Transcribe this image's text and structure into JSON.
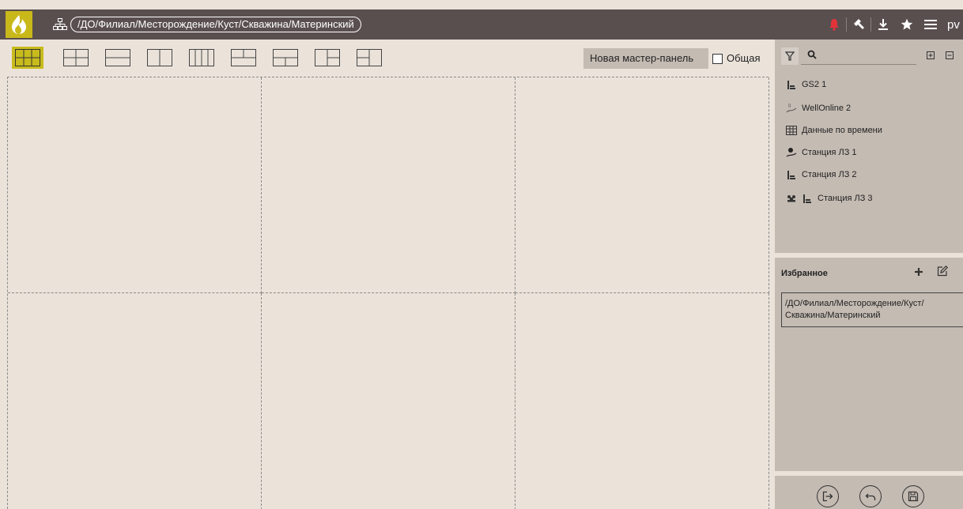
{
  "header": {
    "breadcrumb": "/ДО/Филиал/Месторождение/Куст/Скважина/Материнский",
    "user": "pv",
    "colors": {
      "bar": "#5a4f4f",
      "logo_bg": "#c9b81a",
      "bell": "#e0343a"
    },
    "icons": [
      "bell-icon",
      "hammer-icon",
      "download-icon",
      "star-icon",
      "menu-icon"
    ]
  },
  "toolbar": {
    "layouts": [
      "grid-3x2",
      "grid-2x2",
      "rows-2",
      "cols-2",
      "cols-4",
      "top-1-bottom-2",
      "top-2-bottom-1",
      "left-1-right-2",
      "left-2-right-1"
    ],
    "active_layout": "grid-3x2",
    "panel_name": "Новая мастер-панель",
    "common_label": "Общая",
    "common_checked": false
  },
  "tree": {
    "items": [
      {
        "label": "GS2 1",
        "icon": "pump-jack-icon"
      },
      {
        "label": "WellOnline 2",
        "icon": "well-signal-icon"
      },
      {
        "label": "Данные по времени",
        "icon": "table-icon"
      },
      {
        "label": "Станция ЛЗ 1",
        "icon": "pin-signal-icon"
      },
      {
        "label": "Станция ЛЗ 2",
        "icon": "pump-jack-icon"
      },
      {
        "label": "Станция ЛЗ 3",
        "icon": "pump-jack-icon",
        "prefix_icon": "group-icon"
      }
    ]
  },
  "favorites": {
    "title": "Избранное",
    "items": [
      {
        "line1": "/ДО/Филиал/Месторождение/Куст/",
        "line2": "Скважина/Материнский"
      }
    ]
  },
  "actions": [
    "exit-icon",
    "undo-icon",
    "save-icon"
  ]
}
